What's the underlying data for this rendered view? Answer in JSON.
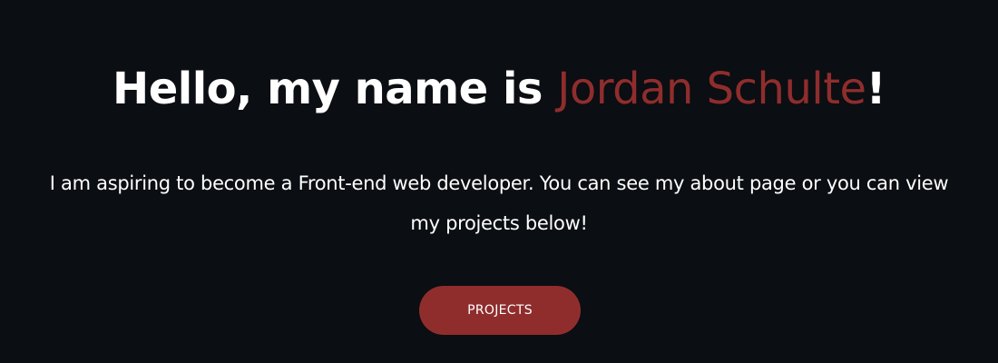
{
  "hero": {
    "title_prefix": "Hello, my name is ",
    "name": "Jordan Schulte",
    "title_suffix": "!",
    "description_line1": "I am aspiring to become a Front-end web developer. You can see my about page or you can view",
    "description_line2": "my projects below!",
    "button_label": "PROJECTS"
  },
  "colors": {
    "background": "#0b0e12",
    "accent": "#8f2d2d",
    "text": "#ffffff"
  }
}
